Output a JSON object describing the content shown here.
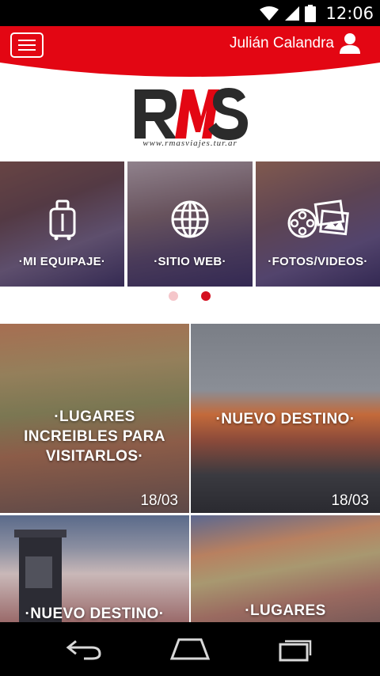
{
  "status_bar": {
    "time": "12:06",
    "icons": [
      "wifi-icon",
      "signal-icon",
      "battery-icon"
    ]
  },
  "header": {
    "menu_icon": "hamburger-menu-icon",
    "user_name": "Julián Calandra",
    "user_icon": "user-icon",
    "accent_color": "#e30613"
  },
  "logo": {
    "text": "RMS",
    "url": "www.rmasviajes.tur.ar"
  },
  "carousel": {
    "slides": [
      {
        "label": "·MI EQUIPAJE·",
        "icon": "luggage-icon"
      },
      {
        "label": "·SITIO WEB·",
        "icon": "globe-icon"
      },
      {
        "label": "·FOTOS/VIDEOS·",
        "icon": "photos-film-icon"
      }
    ],
    "page_count": 2,
    "active_page": 2
  },
  "tiles": [
    {
      "title": "·LUGARES INCREIBLES PARA VISITARLOS·",
      "date": "18/03"
    },
    {
      "title": "·NUEVO DESTINO·",
      "date": "18/03"
    },
    {
      "title": "·NUEVO DESTINO·",
      "date": ""
    },
    {
      "title": "·LUGARES INCREIBLES",
      "date": ""
    }
  ],
  "navbar": {
    "buttons": [
      "back-icon",
      "home-icon",
      "recents-icon"
    ]
  }
}
